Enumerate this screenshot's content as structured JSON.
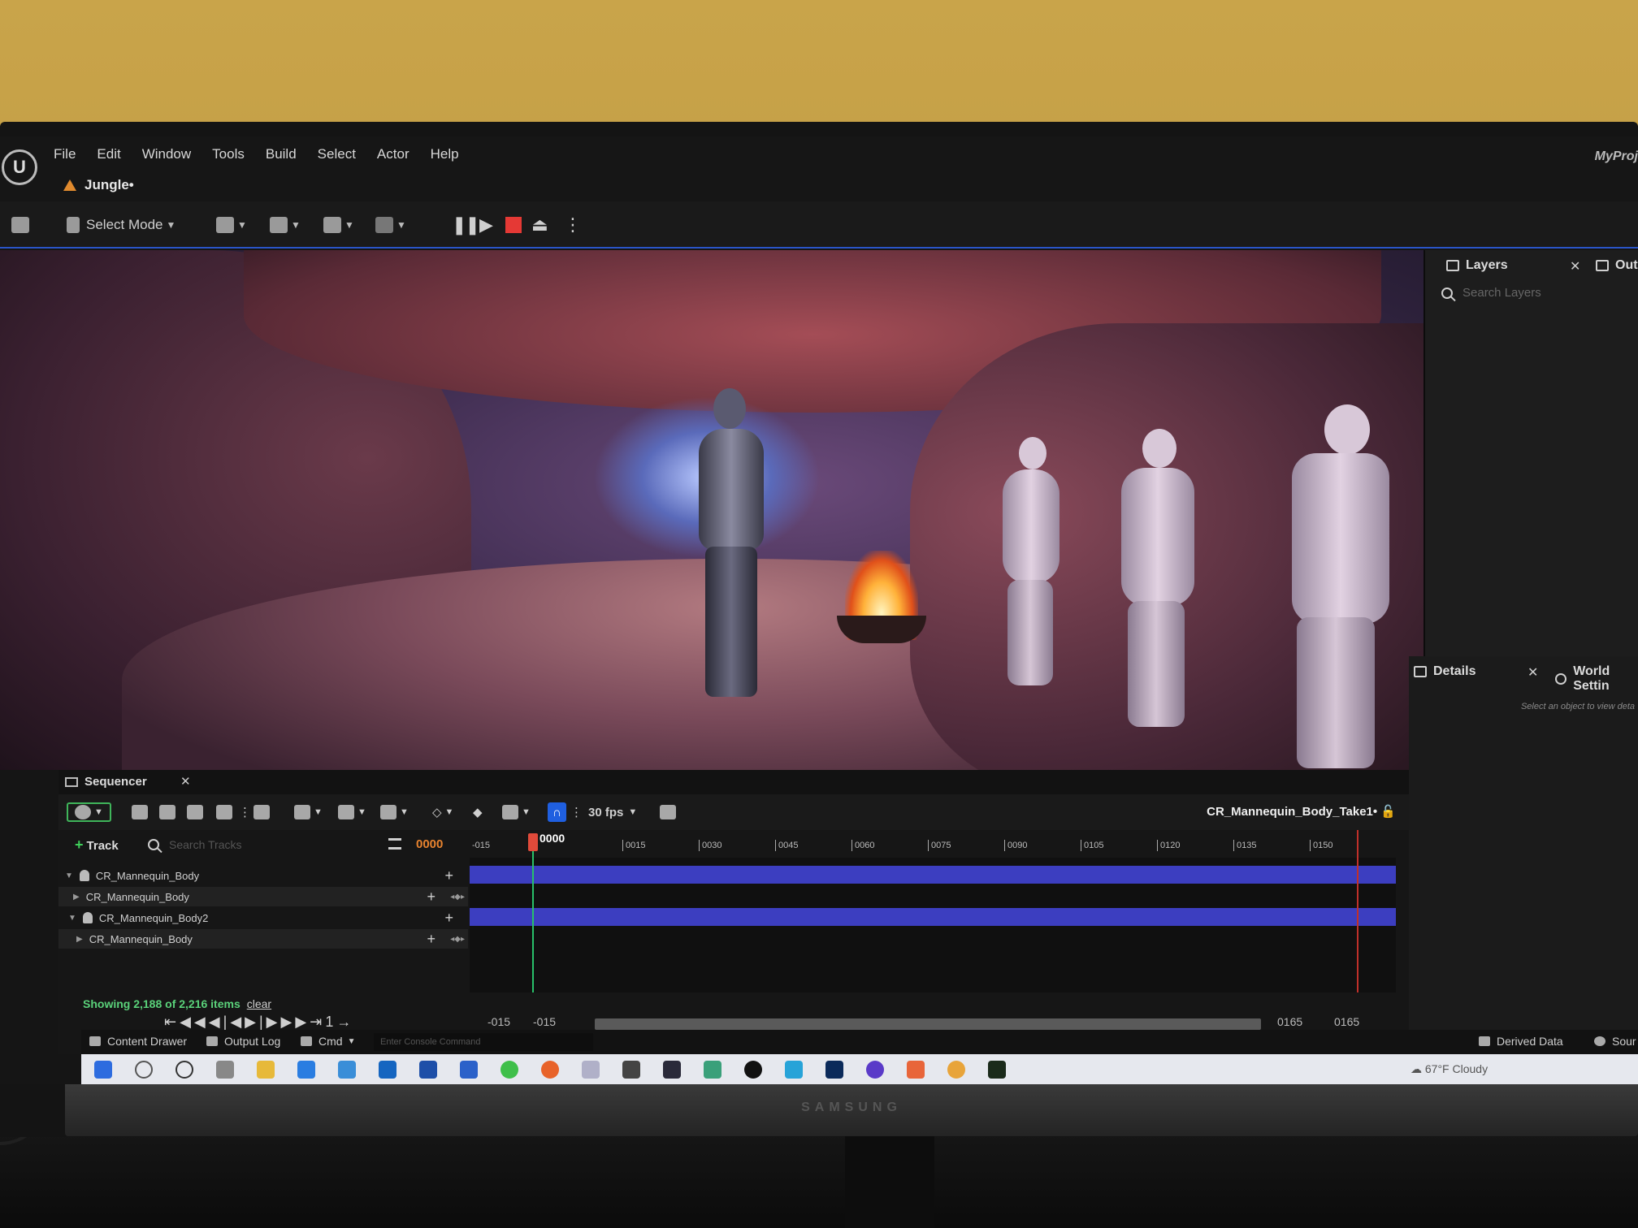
{
  "menu": {
    "items": [
      "File",
      "Edit",
      "Window",
      "Tools",
      "Build",
      "Select",
      "Actor",
      "Help"
    ],
    "level_tab": "Jungle•",
    "project": "MyProj"
  },
  "toolbar": {
    "select_mode": "Select Mode"
  },
  "layers_panel": {
    "tab": "Layers",
    "outliner_tab": "Outl",
    "search_placeholder": "Search Layers"
  },
  "details_panel": {
    "tab": "Details",
    "world_tab": "World Settin",
    "hint": "Select an object to view deta"
  },
  "sequencer": {
    "tab": "Sequencer",
    "fps": "30 fps",
    "sequence_name": "CR_Mannequin_Body_Take1•",
    "add_track": "Track",
    "search_placeholder": "Search Tracks",
    "current_frame": "0000",
    "playhead_label": "0000",
    "tracks": [
      {
        "label": "CR_Mannequin_Body",
        "level": 0
      },
      {
        "label": "CR_Mannequin_Body",
        "level": 1
      },
      {
        "label": "CR_Mannequin_Body2",
        "level": 0
      },
      {
        "label": "CR_Mannequin_Body",
        "level": 1
      }
    ],
    "ruler_ticks": [
      "-015",
      "0015",
      "0030",
      "0045",
      "0060",
      "0075",
      "0090",
      "0105",
      "0120",
      "0135",
      "0150"
    ],
    "status": "Showing 2,188 of 2,216 items",
    "clear": "clear",
    "range": {
      "view_start": "-015",
      "play_start": "-015",
      "play_end": "0165",
      "view_end": "0165"
    }
  },
  "drawer": {
    "content_drawer": "Content Drawer",
    "output_log": "Output Log",
    "cmd": "Cmd",
    "console_placeholder": "Enter Console Command",
    "derived_data": "Derived Data",
    "source": "Sour"
  },
  "taskbar": {
    "weather": "67°F Cloudy"
  },
  "monitor": {
    "brand": "SAMSUNG"
  },
  "colors": {
    "accent_blue": "#1f5fe0",
    "track_bar": "#3c3ec0",
    "frame_orange": "#e8832f",
    "status_green": "#5ad27a",
    "record_red": "#e53935"
  }
}
